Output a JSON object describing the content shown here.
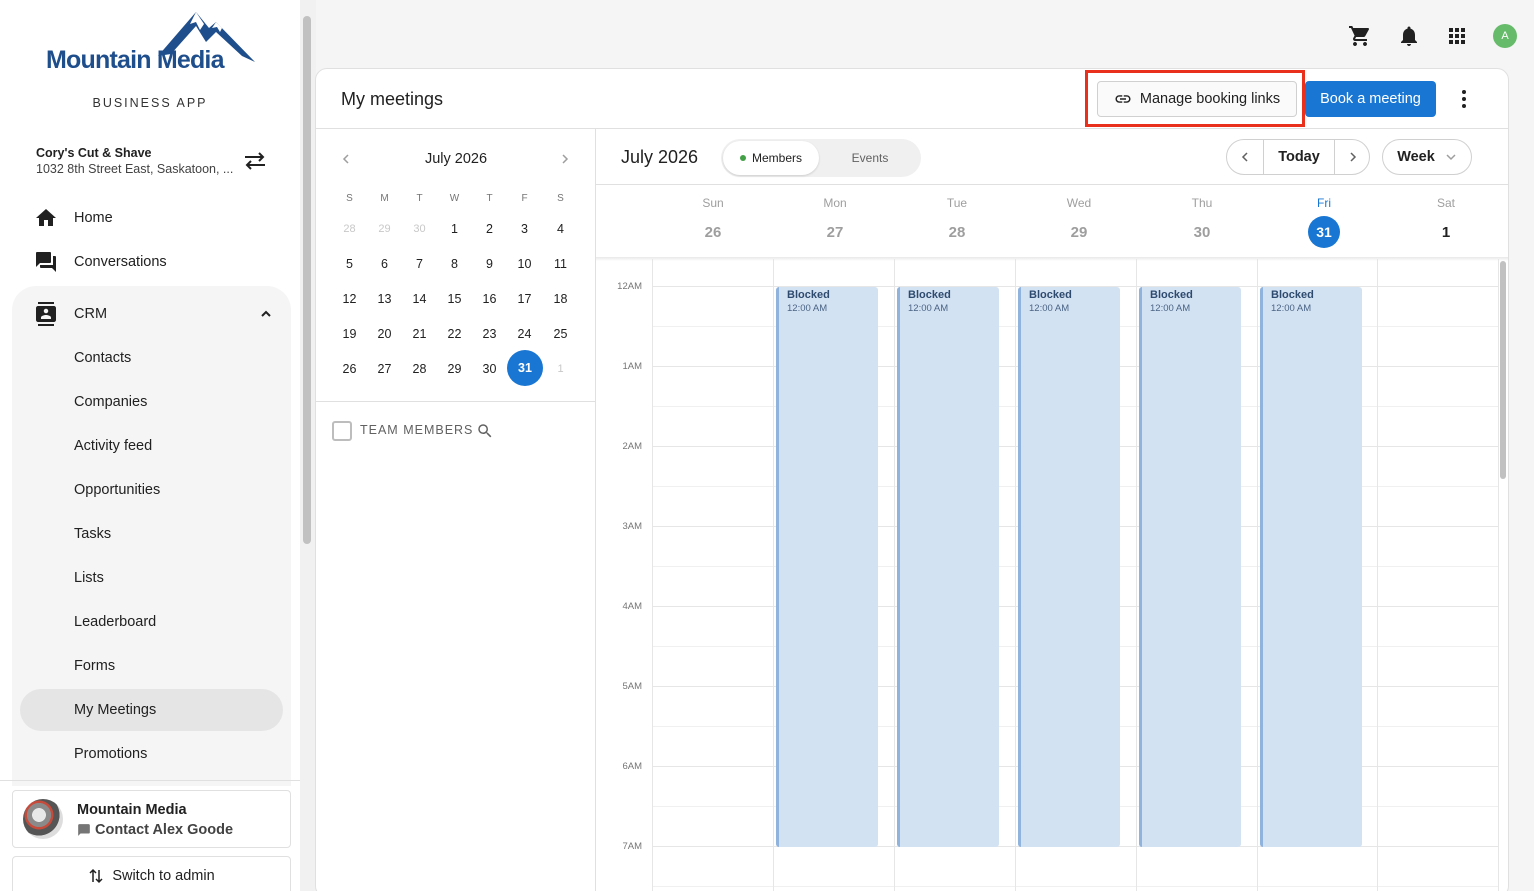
{
  "brand": {
    "logo_text": "Mountain Media",
    "app_label": "BUSINESS APP",
    "brand_color": "#1f4e8c"
  },
  "account": {
    "name": "Cory's Cut & Shave",
    "address": "1032 8th Street East, Saskatoon, ..."
  },
  "nav": {
    "home": "Home",
    "conversations": "Conversations",
    "crm": "CRM",
    "crm_items": [
      "Contacts",
      "Companies",
      "Activity feed",
      "Opportunities",
      "Tasks",
      "Lists",
      "Leaderboard",
      "Forms",
      "My Meetings",
      "Promotions"
    ],
    "active_item": "My Meetings"
  },
  "contact_card": {
    "name": "Mountain Media",
    "contact": "Contact Alex Goode"
  },
  "switch_admin": "Switch to admin",
  "topbar": {
    "avatar_letter": "A",
    "icons": [
      "cart-icon",
      "bell-icon",
      "apps-grid-icon"
    ]
  },
  "header": {
    "title": "My meetings",
    "manage_links": "Manage booking links",
    "book_meeting": "Book a meeting",
    "accent": "#1976d2",
    "highlight_color": "#e8301c"
  },
  "mini_calendar": {
    "title": "July 2026",
    "dow": [
      "S",
      "M",
      "T",
      "W",
      "T",
      "F",
      "S"
    ],
    "weeks": [
      [
        "28",
        "29",
        "30",
        "1",
        "2",
        "3",
        "4"
      ],
      [
        "5",
        "6",
        "7",
        "8",
        "9",
        "10",
        "11"
      ],
      [
        "12",
        "13",
        "14",
        "15",
        "16",
        "17",
        "18"
      ],
      [
        "19",
        "20",
        "21",
        "22",
        "23",
        "24",
        "25"
      ],
      [
        "26",
        "27",
        "28",
        "29",
        "30",
        "31",
        "1"
      ]
    ],
    "selected": "31",
    "team_members": "TEAM MEMBERS"
  },
  "week": {
    "title": "July 2026",
    "toggle_members": "Members",
    "toggle_events": "Events",
    "today": "Today",
    "view": "Week",
    "days": [
      {
        "name": "Sun",
        "num": "26"
      },
      {
        "name": "Mon",
        "num": "27"
      },
      {
        "name": "Tue",
        "num": "28"
      },
      {
        "name": "Wed",
        "num": "29"
      },
      {
        "name": "Thu",
        "num": "30"
      },
      {
        "name": "Fri",
        "num": "31"
      },
      {
        "name": "Sat",
        "num": "1"
      }
    ],
    "hours": [
      "12AM",
      "1AM",
      "2AM",
      "3AM",
      "4AM",
      "5AM",
      "6AM",
      "7AM"
    ],
    "events": [
      {
        "title": "Blocked",
        "time": "12:00 AM"
      },
      {
        "title": "Blocked",
        "time": "12:00 AM"
      },
      {
        "title": "Blocked",
        "time": "12:00 AM"
      },
      {
        "title": "Blocked",
        "time": "12:00 AM"
      },
      {
        "title": "Blocked",
        "time": "12:00 AM"
      }
    ]
  }
}
